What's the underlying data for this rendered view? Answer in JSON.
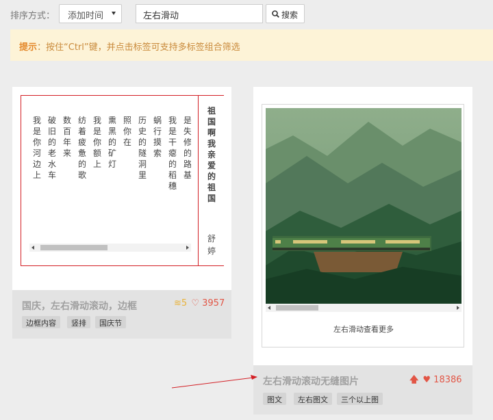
{
  "toolbar": {
    "sort_label": "排序方式：",
    "sort_value": "添加时间",
    "search_value": "左右滑动",
    "search_button": "搜索"
  },
  "notice": {
    "prefix": "提示",
    "text": "：按住“Ctrl”键，并点击标签可支持多标签组合筛选"
  },
  "cards": [
    {
      "poem_columns": [
        "我是你河边上",
        "破旧的老水车",
        "数百年来",
        "纺着疲惫的歌",
        "我是你额上",
        "熏黑的矿灯",
        "照你在",
        "历史的隧洞里",
        "蜗行摸索",
        "我是干瘪的稻穗",
        "是失修的路基"
      ],
      "side_title": "祖国啊我亲爱的祖国",
      "side_author": "舒婷",
      "title": "国庆，左右滑动滚动，边框",
      "coins": "5",
      "likes": "3957",
      "tags": [
        "边框内容",
        "竖排",
        "国庆节"
      ]
    },
    {
      "caption": "左右滑动查看更多",
      "title": "左右滑动滚动无缝图片",
      "likes": "18386",
      "tags": [
        "图文",
        "左右图文",
        "三个以上图"
      ]
    }
  ],
  "colors": {
    "accent": "#e25545",
    "coin": "#e9b33a",
    "border_red": "#d31e24",
    "notice_bg": "#fdf3d7"
  },
  "icons": [
    "search-icon",
    "coin-icon",
    "heart-outline-icon",
    "up-arrow-icon",
    "heart-icon"
  ]
}
